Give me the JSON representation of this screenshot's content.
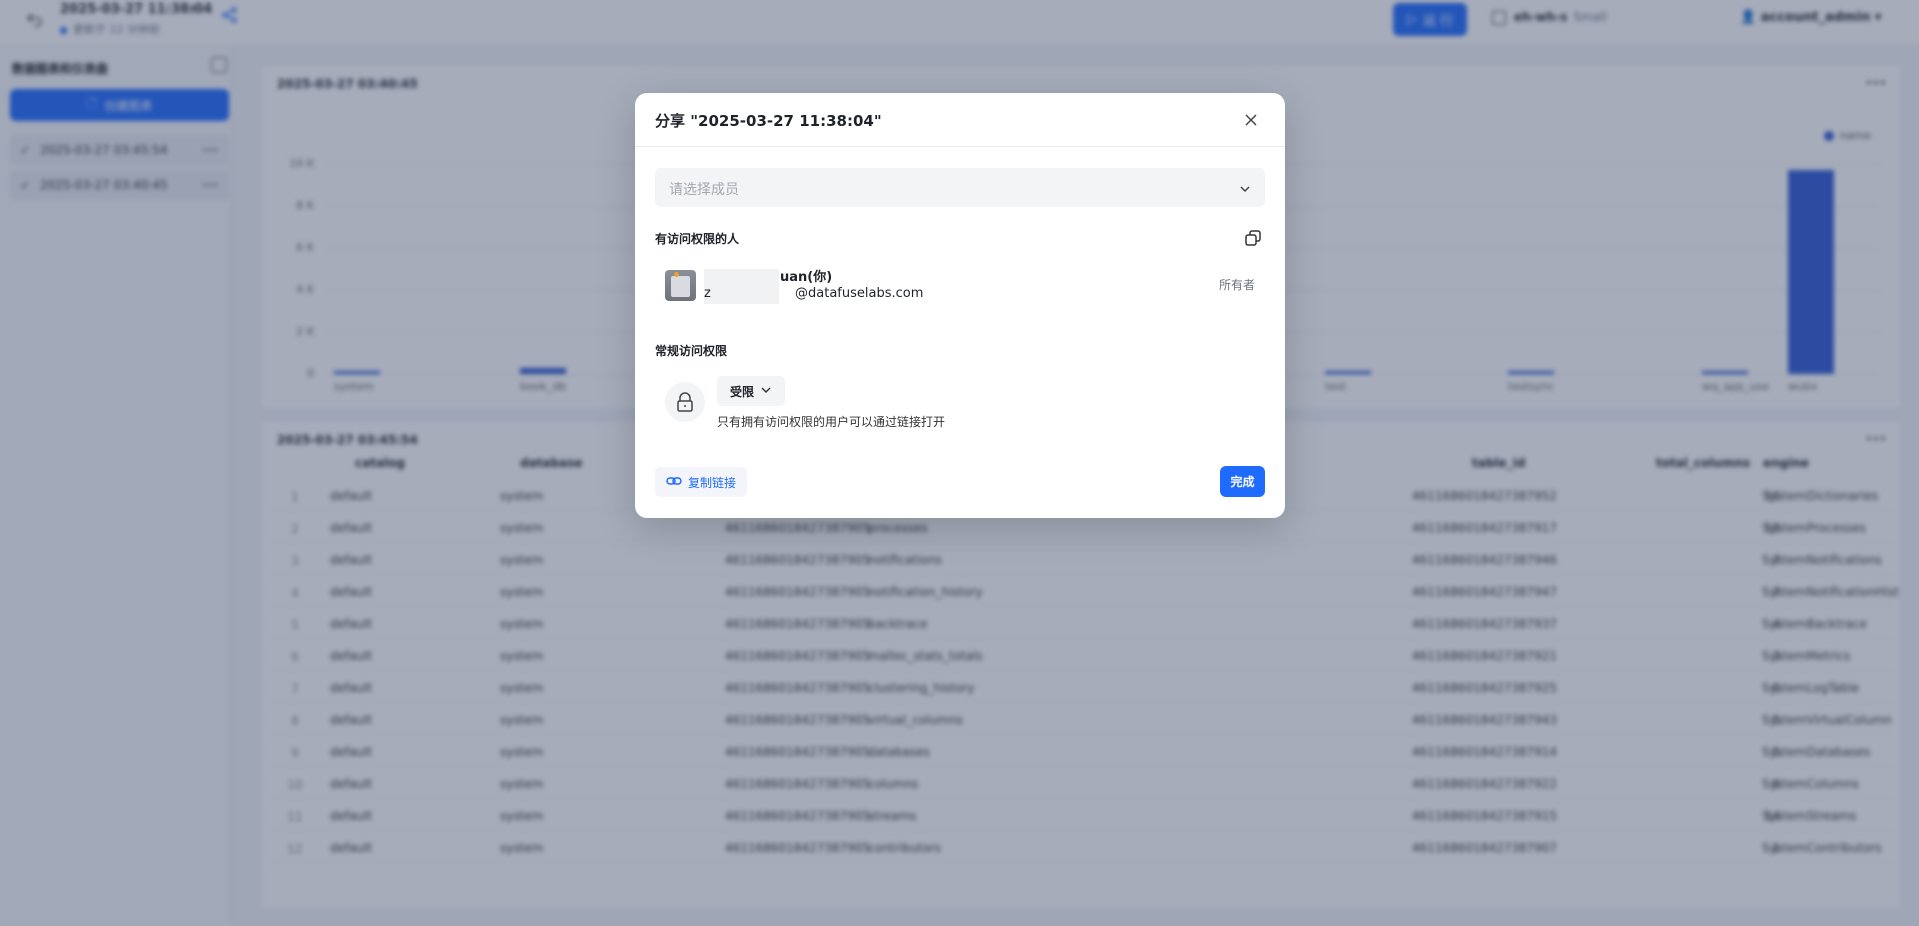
{
  "topbar": {
    "title": "2025-03-27 11:38:04",
    "subtitle": "更新于 12 分钟前",
    "run_label": "运 行",
    "warehouse_name": "eh-wh-s",
    "warehouse_size": "Small",
    "user": "account_admin"
  },
  "sidebar": {
    "title": "数据图表和仪表盘",
    "create_label": "创建图表",
    "items": [
      {
        "label": "2025-03-27 03:45:54"
      },
      {
        "label": "2025-03-27 03:40:45"
      }
    ]
  },
  "chart_panel": {
    "title": "2025-03-27 03:40:45",
    "legend": "name",
    "chart_data": {
      "type": "bar",
      "categories": [
        "system",
        "book_db",
        "test",
        "testsync",
        "wq_app_use",
        "wubx"
      ],
      "values": [
        120,
        300,
        0,
        0,
        0,
        9700
      ],
      "yticks": [
        "10 K",
        "8 K",
        "6 K",
        "4 K",
        "2 K",
        "0"
      ],
      "ylim": [
        0,
        10000
      ]
    }
  },
  "table_panel": {
    "title": "2025-03-27 03:45:54",
    "columns": [
      "catalog",
      "database",
      "table_id",
      "total_columns",
      "engine"
    ],
    "rows": [
      [
        "1",
        "default",
        "system",
        "4611686018427387905",
        "processes",
        "4611686018427387952",
        "10",
        "SystemDictionaries"
      ],
      [
        "2",
        "default",
        "system",
        "4611686018427387905",
        "processes",
        "4611686018427387917",
        "18",
        "SystemProcesses"
      ],
      [
        "3",
        "default",
        "system",
        "4611686018427387905",
        "notifications",
        "4611686018427387946",
        "7",
        "SystemNotifications"
      ],
      [
        "4",
        "default",
        "system",
        "4611686018427387905",
        "notification_history",
        "4611686018427387947",
        "7",
        "SystemNotificationHist"
      ],
      [
        "5",
        "default",
        "system",
        "4611686018427387905",
        "backtrace",
        "4611686018427387937",
        "4",
        "SystemBacktrace"
      ],
      [
        "6",
        "default",
        "system",
        "4611686018427387905",
        "malloc_stats_totals",
        "4611686018427387921",
        "3",
        "SystemMetrics"
      ],
      [
        "7",
        "default",
        "system",
        "4611686018427387905",
        "clustering_history",
        "4611686018427387925",
        "6",
        "SystemLogTable"
      ],
      [
        "8",
        "default",
        "system",
        "4611686018427387905",
        "virtual_columns",
        "4611686018427387943",
        "5",
        "SystemVirtualColumn"
      ],
      [
        "9",
        "default",
        "system",
        "4611686018427387905",
        "databases",
        "4611686018427387914",
        "5",
        "SystemDatabases"
      ],
      [
        "10",
        "default",
        "system",
        "4611686018427387905",
        "columns",
        "4611686018427387922",
        "9",
        "SystemColumns"
      ],
      [
        "11",
        "default",
        "system",
        "4611686018427387905",
        "streams",
        "4611686018427387915",
        "14",
        "SystemStreams"
      ],
      [
        "12",
        "default",
        "system",
        "4611686018427387905",
        "contributors",
        "4611686018427387907",
        "1",
        "SystemContributors"
      ]
    ]
  },
  "modal": {
    "title": "分享 \"2025-03-27 11:38:04\"",
    "member_placeholder": "请选择成员",
    "people_label": "有访问权限的人",
    "user_name": "uan(你)",
    "user_email_prefix": "z",
    "user_email_domain": "@datafuselabs.com",
    "owner_label": "所有者",
    "general_access_label": "常规访问权限",
    "access_level": "受限",
    "access_desc": "只有拥有访问权限的用户可以通过链接打开",
    "copy_link_label": "复制链接",
    "done_label": "完成"
  },
  "colors": {
    "accent": "#1f6bff",
    "bar": "#2f5bd4",
    "overlay": "rgba(44,58,90,0.42)"
  }
}
